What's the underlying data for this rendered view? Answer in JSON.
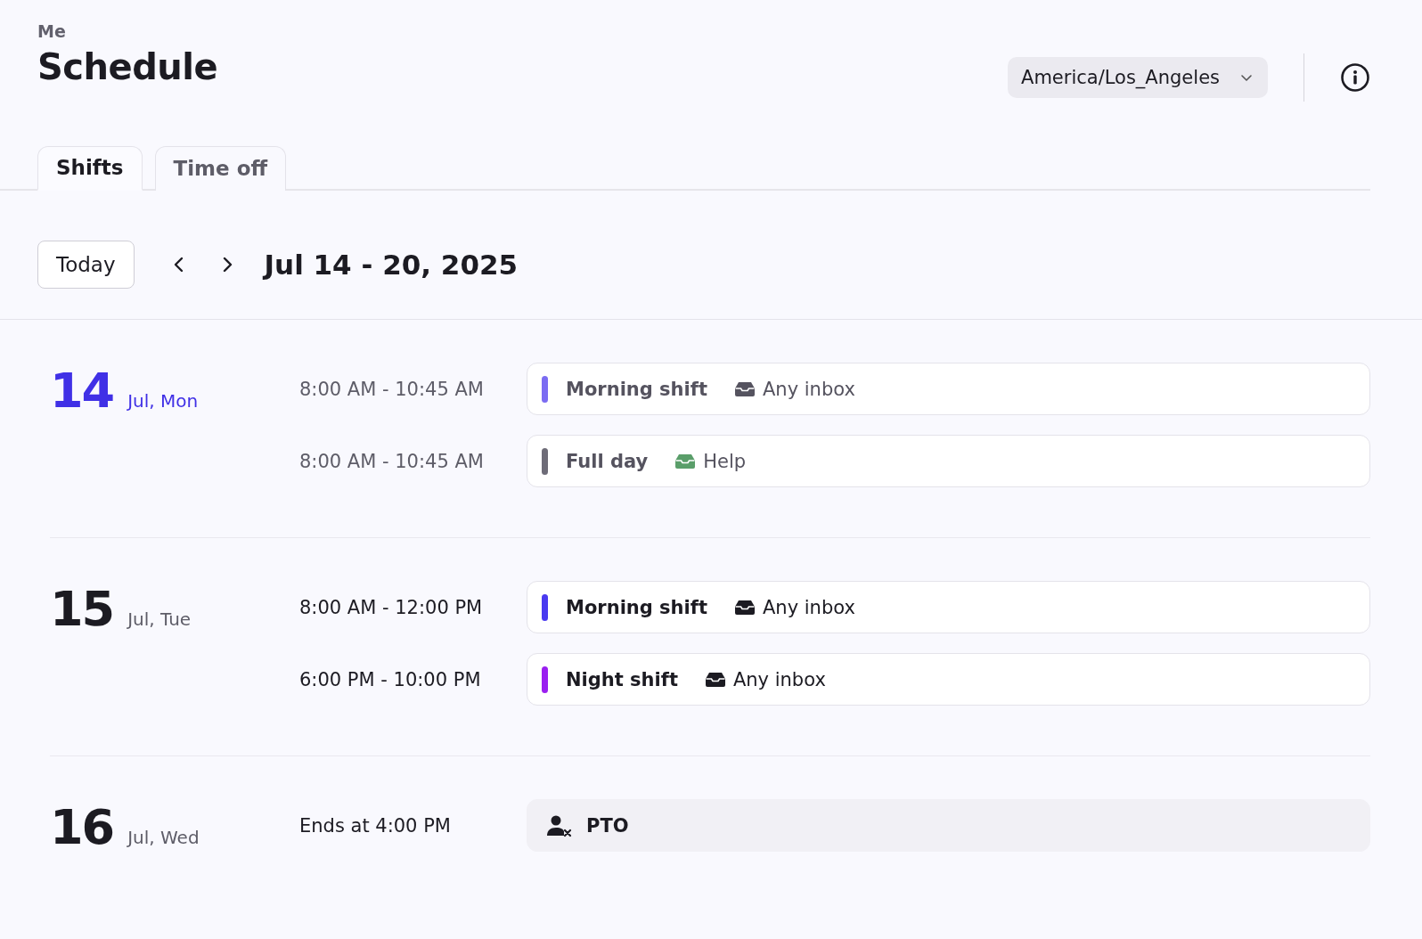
{
  "breadcrumb": "Me",
  "title": "Schedule",
  "timezone": {
    "value": "America/Los_Angeles"
  },
  "tabs": [
    {
      "label": "Shifts",
      "selected": true
    },
    {
      "label": "Time off",
      "selected": false
    }
  ],
  "toolbar": {
    "today_button": "Today",
    "range": "Jul 14 - 20, 2025"
  },
  "days": [
    {
      "day": "14",
      "label": "Jul, Mon",
      "today": true,
      "entries": [
        {
          "kind": "shift",
          "time": "8:00 AM - 10:45 AM",
          "name": "Morning shift",
          "color": "#7b6cf2",
          "past": true,
          "inbox": {
            "label": "Any inbox",
            "color": "#55535f"
          }
        },
        {
          "kind": "shift",
          "time": "8:00 AM - 10:45 AM",
          "name": "Full day",
          "color": "#6e6c78",
          "past": true,
          "inbox": {
            "label": "Help",
            "color": "#5a9e6a"
          }
        }
      ]
    },
    {
      "day": "15",
      "label": "Jul, Tue",
      "today": false,
      "entries": [
        {
          "kind": "shift",
          "time": "8:00 AM - 12:00 PM",
          "name": "Morning shift",
          "color": "#4a3af0",
          "past": false,
          "inbox": {
            "label": "Any inbox",
            "color": "#1c1b22"
          }
        },
        {
          "kind": "shift",
          "time": "6:00 PM - 10:00 PM",
          "name": "Night shift",
          "color": "#9a1ff0",
          "past": false,
          "inbox": {
            "label": "Any inbox",
            "color": "#1c1b22"
          }
        }
      ]
    },
    {
      "day": "16",
      "label": "Jul, Wed",
      "today": false,
      "entries": [
        {
          "kind": "timeoff",
          "time": "Ends at 4:00 PM",
          "name": "PTO"
        }
      ]
    }
  ]
}
